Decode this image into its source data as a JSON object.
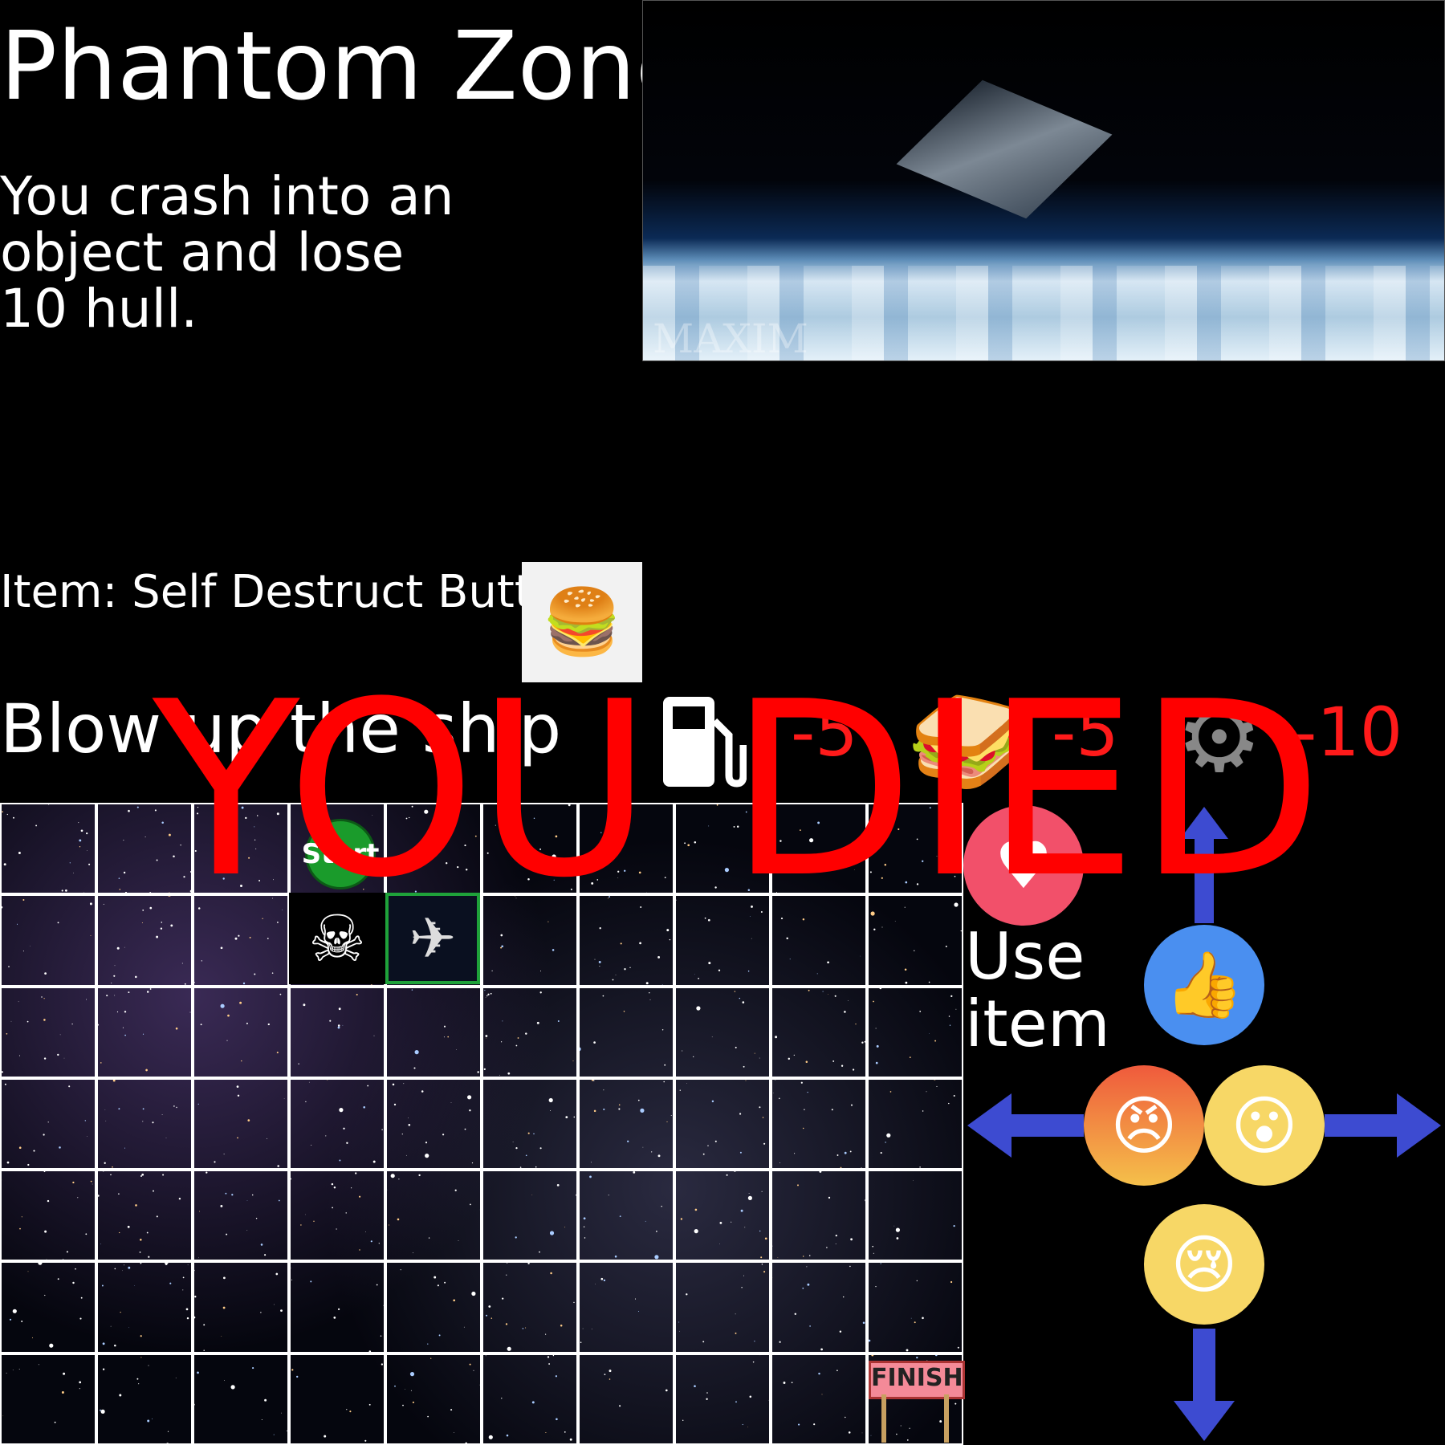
{
  "game": {
    "title": "Phantom Zone",
    "event_text": "You crash into an object and lose 10 hull.",
    "scene_watermark": "MAXIM",
    "item_label": "Item: Self Destruct Button",
    "item_icon": "burger-icon",
    "objective": "Blow up the ship",
    "death_message": "YOU DIED"
  },
  "stats": {
    "fuel": {
      "icon": "fuel-pump-icon",
      "value": "-5"
    },
    "food": {
      "icon": "sandwich-icon",
      "value": "-5"
    },
    "hull": {
      "icon": "gear-icon",
      "value": "-10"
    }
  },
  "board": {
    "rows": 7,
    "cols": 10,
    "start_label": "Start",
    "finish_label": "FINISH",
    "player_icon": "spaceship-icon",
    "enemy_icon": "cthulhu-icon"
  },
  "controls": {
    "use_item_label": "Use item",
    "use_item_icon": "heart-reaction-icon",
    "up_icon": "like-reaction-icon",
    "left_icon": "angry-reaction-icon",
    "right_icon": "wow-reaction-icon",
    "down_icon": "sad-reaction-icon",
    "arrow_color": "#3d4bd1"
  },
  "colors": {
    "background": "#000000",
    "warning": "#ff0000",
    "grid_line": "#ffffff",
    "player_border": "#1fa23a"
  }
}
